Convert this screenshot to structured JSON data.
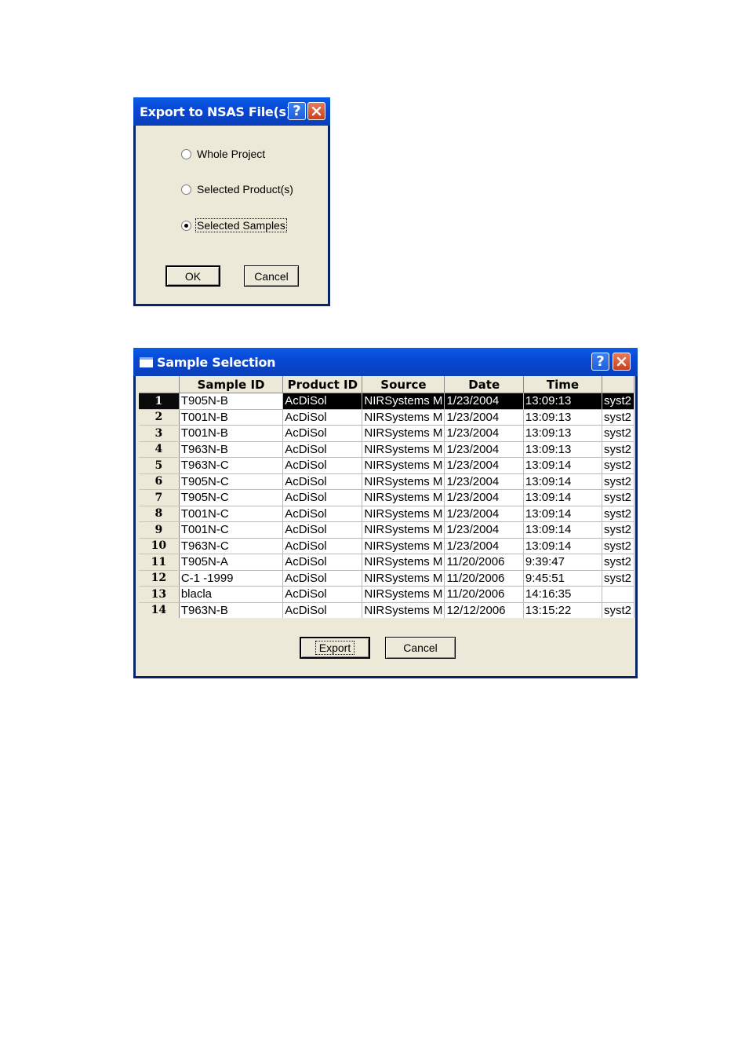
{
  "export_dialog": {
    "title": "Export to NSAS File(s)",
    "options": [
      {
        "label": "Whole Project",
        "checked": false
      },
      {
        "label": "Selected Product(s)",
        "checked": false
      },
      {
        "label": "Selected Samples",
        "checked": true
      }
    ],
    "ok_label": "OK",
    "cancel_label": "Cancel"
  },
  "sample_dialog": {
    "title": "Sample Selection",
    "columns": [
      "",
      "Sample ID",
      "Product ID",
      "Source",
      "Date",
      "Time",
      ""
    ],
    "rows": [
      {
        "n": "1",
        "sample_id": "T905N-B",
        "product_id": "AcDiSol",
        "source": "NIRSystems M",
        "date": "1/23/2004",
        "time": "13:09:13",
        "extra": "syst2"
      },
      {
        "n": "2",
        "sample_id": "T001N-B",
        "product_id": "AcDiSol",
        "source": "NIRSystems M",
        "date": "1/23/2004",
        "time": "13:09:13",
        "extra": "syst2"
      },
      {
        "n": "3",
        "sample_id": "T001N-B",
        "product_id": "AcDiSol",
        "source": "NIRSystems M",
        "date": "1/23/2004",
        "time": "13:09:13",
        "extra": "syst2"
      },
      {
        "n": "4",
        "sample_id": "T963N-B",
        "product_id": "AcDiSol",
        "source": "NIRSystems M",
        "date": "1/23/2004",
        "time": "13:09:13",
        "extra": "syst2"
      },
      {
        "n": "5",
        "sample_id": "T963N-C",
        "product_id": "AcDiSol",
        "source": "NIRSystems M",
        "date": "1/23/2004",
        "time": "13:09:14",
        "extra": "syst2"
      },
      {
        "n": "6",
        "sample_id": "T905N-C",
        "product_id": "AcDiSol",
        "source": "NIRSystems M",
        "date": "1/23/2004",
        "time": "13:09:14",
        "extra": "syst2"
      },
      {
        "n": "7",
        "sample_id": "T905N-C",
        "product_id": "AcDiSol",
        "source": "NIRSystems M",
        "date": "1/23/2004",
        "time": "13:09:14",
        "extra": "syst2"
      },
      {
        "n": "8",
        "sample_id": "T001N-C",
        "product_id": "AcDiSol",
        "source": "NIRSystems M",
        "date": "1/23/2004",
        "time": "13:09:14",
        "extra": "syst2"
      },
      {
        "n": "9",
        "sample_id": "T001N-C",
        "product_id": "AcDiSol",
        "source": "NIRSystems M",
        "date": "1/23/2004",
        "time": "13:09:14",
        "extra": "syst2"
      },
      {
        "n": "10",
        "sample_id": "T963N-C",
        "product_id": "AcDiSol",
        "source": "NIRSystems M",
        "date": "1/23/2004",
        "time": "13:09:14",
        "extra": "syst2"
      },
      {
        "n": "11",
        "sample_id": "T905N-A",
        "product_id": "AcDiSol",
        "source": "NIRSystems M",
        "date": "11/20/2006",
        "time": "9:39:47",
        "extra": "syst2"
      },
      {
        "n": "12",
        "sample_id": "C-1 -1999",
        "product_id": "AcDiSol",
        "source": "NIRSystems M",
        "date": "11/20/2006",
        "time": "9:45:51",
        "extra": "syst2"
      },
      {
        "n": "13",
        "sample_id": "blacla",
        "product_id": "AcDiSol",
        "source": "NIRSystems M",
        "date": "11/20/2006",
        "time": "14:16:35",
        "extra": ""
      },
      {
        "n": "14",
        "sample_id": "T963N-B",
        "product_id": "AcDiSol",
        "source": "NIRSystems M",
        "date": "12/12/2006",
        "time": "13:15:22",
        "extra": "syst2"
      }
    ],
    "selected_row": 0,
    "export_label": "Export",
    "cancel_label": "Cancel"
  }
}
